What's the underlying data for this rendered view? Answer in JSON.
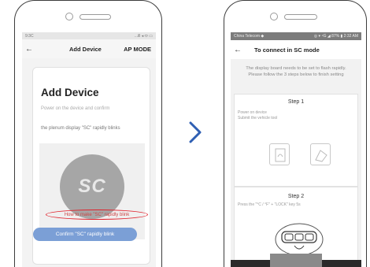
{
  "left_phone": {
    "status_time": "9:3C",
    "status_icons": "...ill ◂ ⬭ ▭",
    "header_title": "Add Device",
    "header_mode": "AP MODE",
    "card_title": "Add Device",
    "instruction_line1": "Power on the device and confirm",
    "instruction_line2": "the plenum display \"SC\" rapidly blinks",
    "display_code": "SC",
    "help_link": "How to make \"SC\" rapidly blink",
    "confirm_button": "Confirm \"SC\" rapidly blink"
  },
  "right_phone": {
    "status_left": "China Telecom ◆",
    "status_right": "◎ ▾ ⁴G ◢ 87% ▮ 2:32 AM",
    "header_title": "To connect in SC mode",
    "intro_text": "The display board needs to be set to flash rapidly. Please follow the 3 steps below to finish setting",
    "step1_title": "Step 1",
    "step1_desc": "Power on device\nSubmit the vehicle tool",
    "step2_title": "Step 2",
    "step2_desc": "Press the \"°C / °F\" + \"LOCK\" key 5s"
  },
  "colors": {
    "accent_button": "#7b9fd6",
    "arrow": "#2f5fb3",
    "highlight_ring": "#e0202a"
  }
}
